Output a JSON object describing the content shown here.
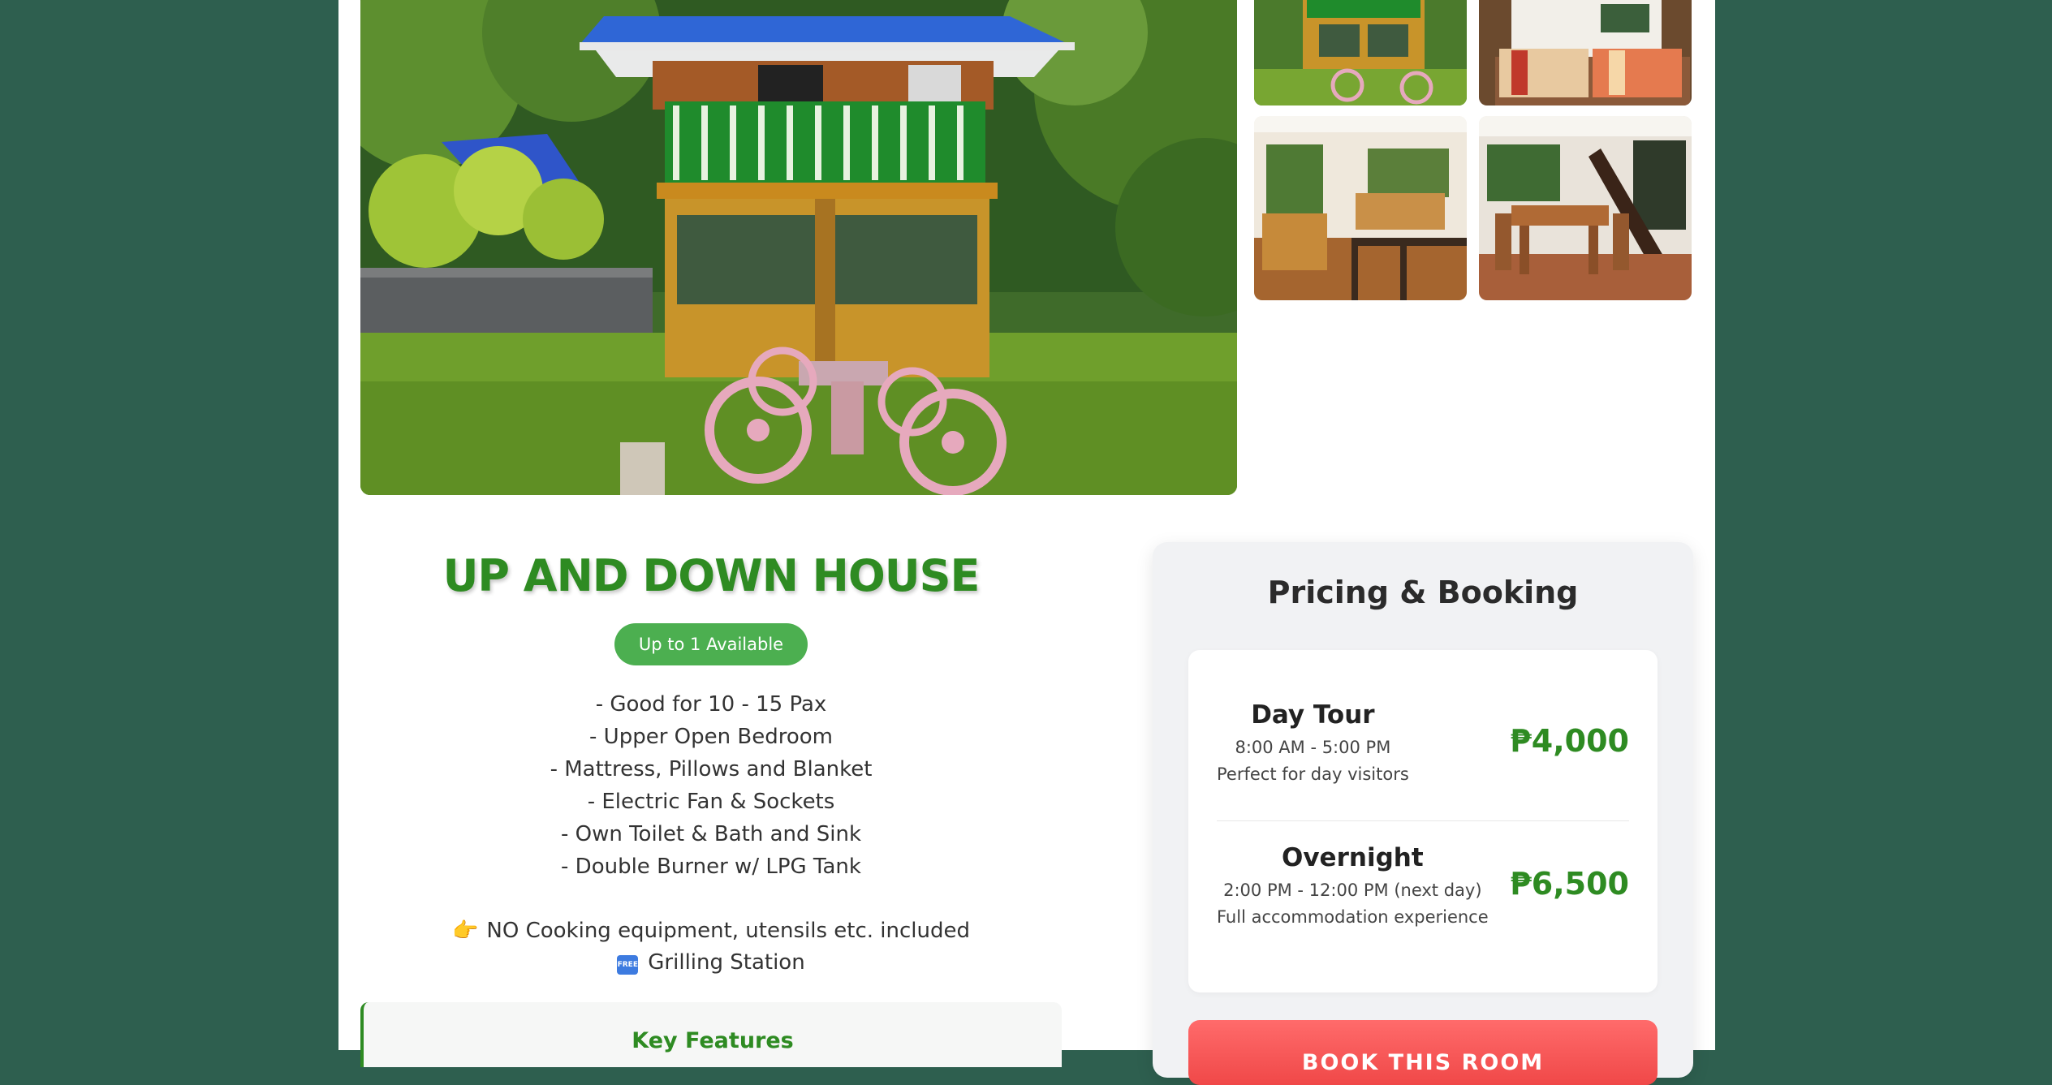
{
  "room": {
    "title": "UP AND DOWN HOUSE",
    "availability": "Up to 1 Available",
    "features": [
      "- Good for 10 - 15 Pax",
      "- Upper Open Bedroom",
      "- Mattress, Pillows and Blanket",
      "- Electric Fan & Sockets",
      "- Own Toilet & Bath and Sink",
      "- Double Burner w/ LPG Tank"
    ],
    "notes": [
      {
        "icon": "👉",
        "text": "NO Cooking equipment, utensils etc. included"
      },
      {
        "icon": "FREE",
        "text": "Grilling Station"
      }
    ],
    "key_features_title": "Key Features"
  },
  "pricing": {
    "title": "Pricing & Booking",
    "rates": [
      {
        "name": "Day Tour",
        "time": "8:00 AM - 5:00 PM",
        "description": "Perfect for day visitors",
        "price": "₱4,000"
      },
      {
        "name": "Overnight",
        "time": "2:00 PM - 12:00 PM (next day)",
        "description": "Full accommodation experience",
        "price": "₱6,500"
      }
    ],
    "book_label": "BOOK THIS ROOM"
  },
  "colors": {
    "page_background": "#2e5f4f",
    "accent_green": "#2e8b22",
    "badge_green": "#4caf50",
    "book_button": "#f04848"
  },
  "gallery": {
    "main_image": "house-exterior-photo",
    "thumbnails": [
      "exterior-thumb",
      "bedroom-thumb",
      "living-room-thumb",
      "dining-room-thumb"
    ]
  }
}
